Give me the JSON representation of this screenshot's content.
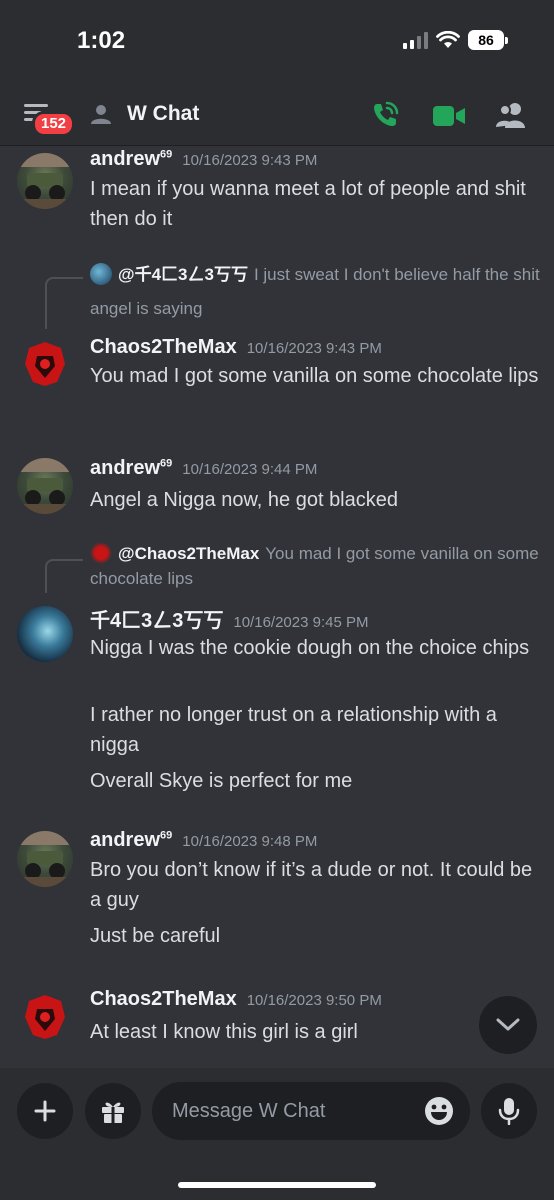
{
  "status_bar": {
    "time": "1:02",
    "battery": "86"
  },
  "header": {
    "notification_count": "152",
    "title": "W Chat"
  },
  "messages": [
    {
      "author": "andrew",
      "author_suffix": "69",
      "timestamp": "10/16/2023 9:43 PM",
      "lines": [
        "I mean if you wanna meet a lot of people and shit then do it"
      ]
    },
    {
      "reply_to": "@千4匚3ㄥ3丂丂",
      "reply_text": "I just sweat I don't believe half the shit angel is saying",
      "author": "Chaos2TheMax",
      "timestamp": "10/16/2023 9:43 PM",
      "lines": [
        "You mad I got some vanilla on some chocolate lips"
      ]
    },
    {
      "author": "andrew",
      "author_suffix": "69",
      "timestamp": "10/16/2023 9:44 PM",
      "lines": [
        "Angel a Nigga now, he got blacked"
      ]
    },
    {
      "reply_to": "@Chaos2TheMax",
      "reply_text": "You mad I got some vanilla on some chocolate lips",
      "author": "千4匚3ㄥ3丂丂",
      "timestamp": "10/16/2023 9:45 PM",
      "lines": [
        "Nigga I was the cookie dough on the choice chips",
        "I rather no longer trust on a relationship with a nigga",
        "Overall Skye is perfect for me"
      ]
    },
    {
      "author": "andrew",
      "author_suffix": "69",
      "timestamp": "10/16/2023 9:48 PM",
      "lines": [
        "Bro you don’t know if it’s a dude or not. It could be a guy",
        "Just be careful"
      ]
    },
    {
      "author": "Chaos2TheMax",
      "timestamp": "10/16/2023 9:50 PM",
      "lines": [
        "At least I know this girl is a girl"
      ]
    }
  ],
  "composer": {
    "placeholder": "Message W Chat"
  },
  "colors": {
    "background": "#313338",
    "header": "#2b2d31",
    "call_green": "#23a55a",
    "badge_red": "#f23f43"
  }
}
